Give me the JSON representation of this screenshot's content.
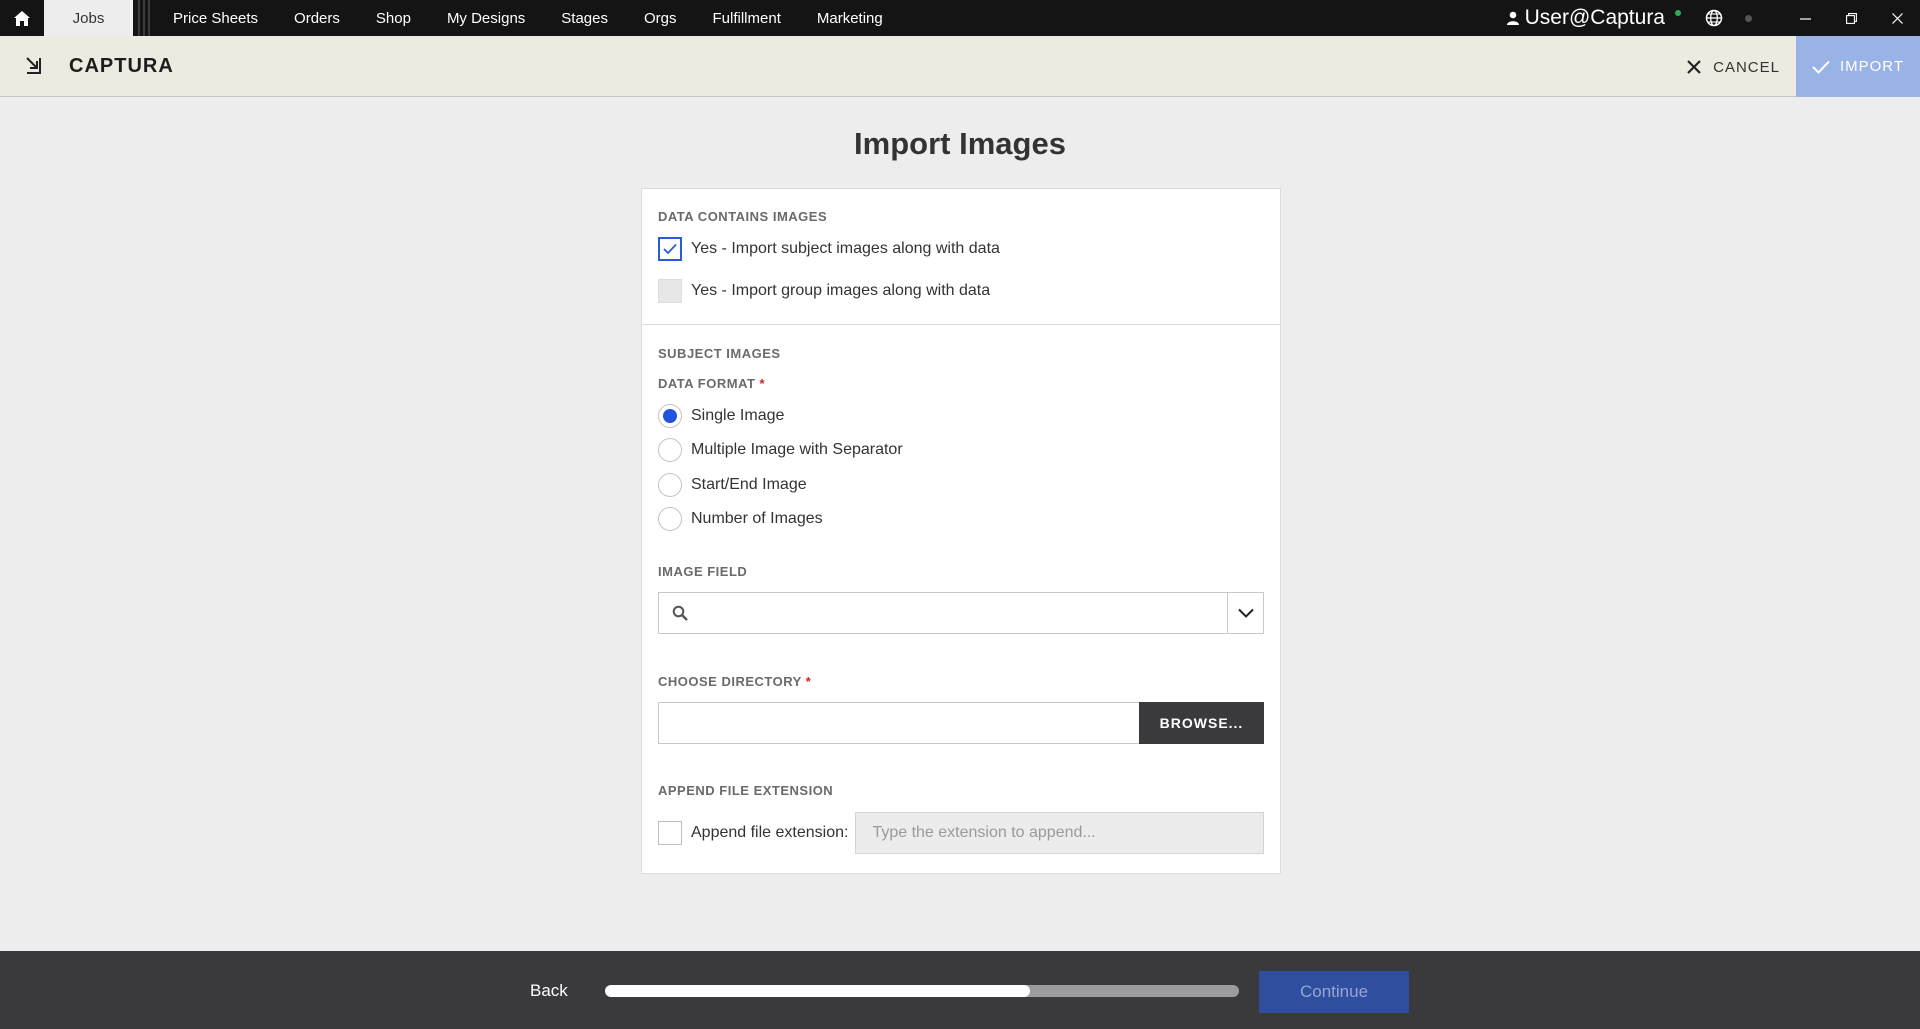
{
  "topnav": {
    "active_tab": "Jobs",
    "items": [
      "Price Sheets",
      "Orders",
      "Shop",
      "My Designs",
      "Stages",
      "Orgs",
      "Fulfillment",
      "Marketing"
    ],
    "user": "User@Captura"
  },
  "header": {
    "brand": "CAPTURA",
    "cancel_label": "CANCEL",
    "import_label": "IMPORT"
  },
  "page": {
    "title": "Import Images"
  },
  "form": {
    "data_contains_images": {
      "label": "DATA CONTAINS IMAGES",
      "options": [
        {
          "label": "Yes - Import subject images along with data",
          "checked": true
        },
        {
          "label": "Yes - Import group images along with data",
          "checked": false
        }
      ]
    },
    "subject_images_label": "SUBJECT IMAGES",
    "data_format": {
      "label": "DATA FORMAT",
      "required_mark": "*",
      "options": [
        {
          "label": "Single Image",
          "selected": true
        },
        {
          "label": "Multiple Image with Separator",
          "selected": false
        },
        {
          "label": "Start/End Image",
          "selected": false
        },
        {
          "label": "Number of Images",
          "selected": false
        }
      ]
    },
    "image_field": {
      "label": "IMAGE FIELD",
      "value": ""
    },
    "choose_directory": {
      "label": "CHOOSE DIRECTORY",
      "required_mark": "*",
      "value": "",
      "browse_label": "BROWSE..."
    },
    "append_extension": {
      "label": "APPEND FILE EXTENSION",
      "checkbox_label": "Append file extension:",
      "checked": false,
      "placeholder": "Type the extension to append..."
    }
  },
  "footer": {
    "back_label": "Back",
    "progress": 0.67,
    "continue_label": "Continue"
  }
}
